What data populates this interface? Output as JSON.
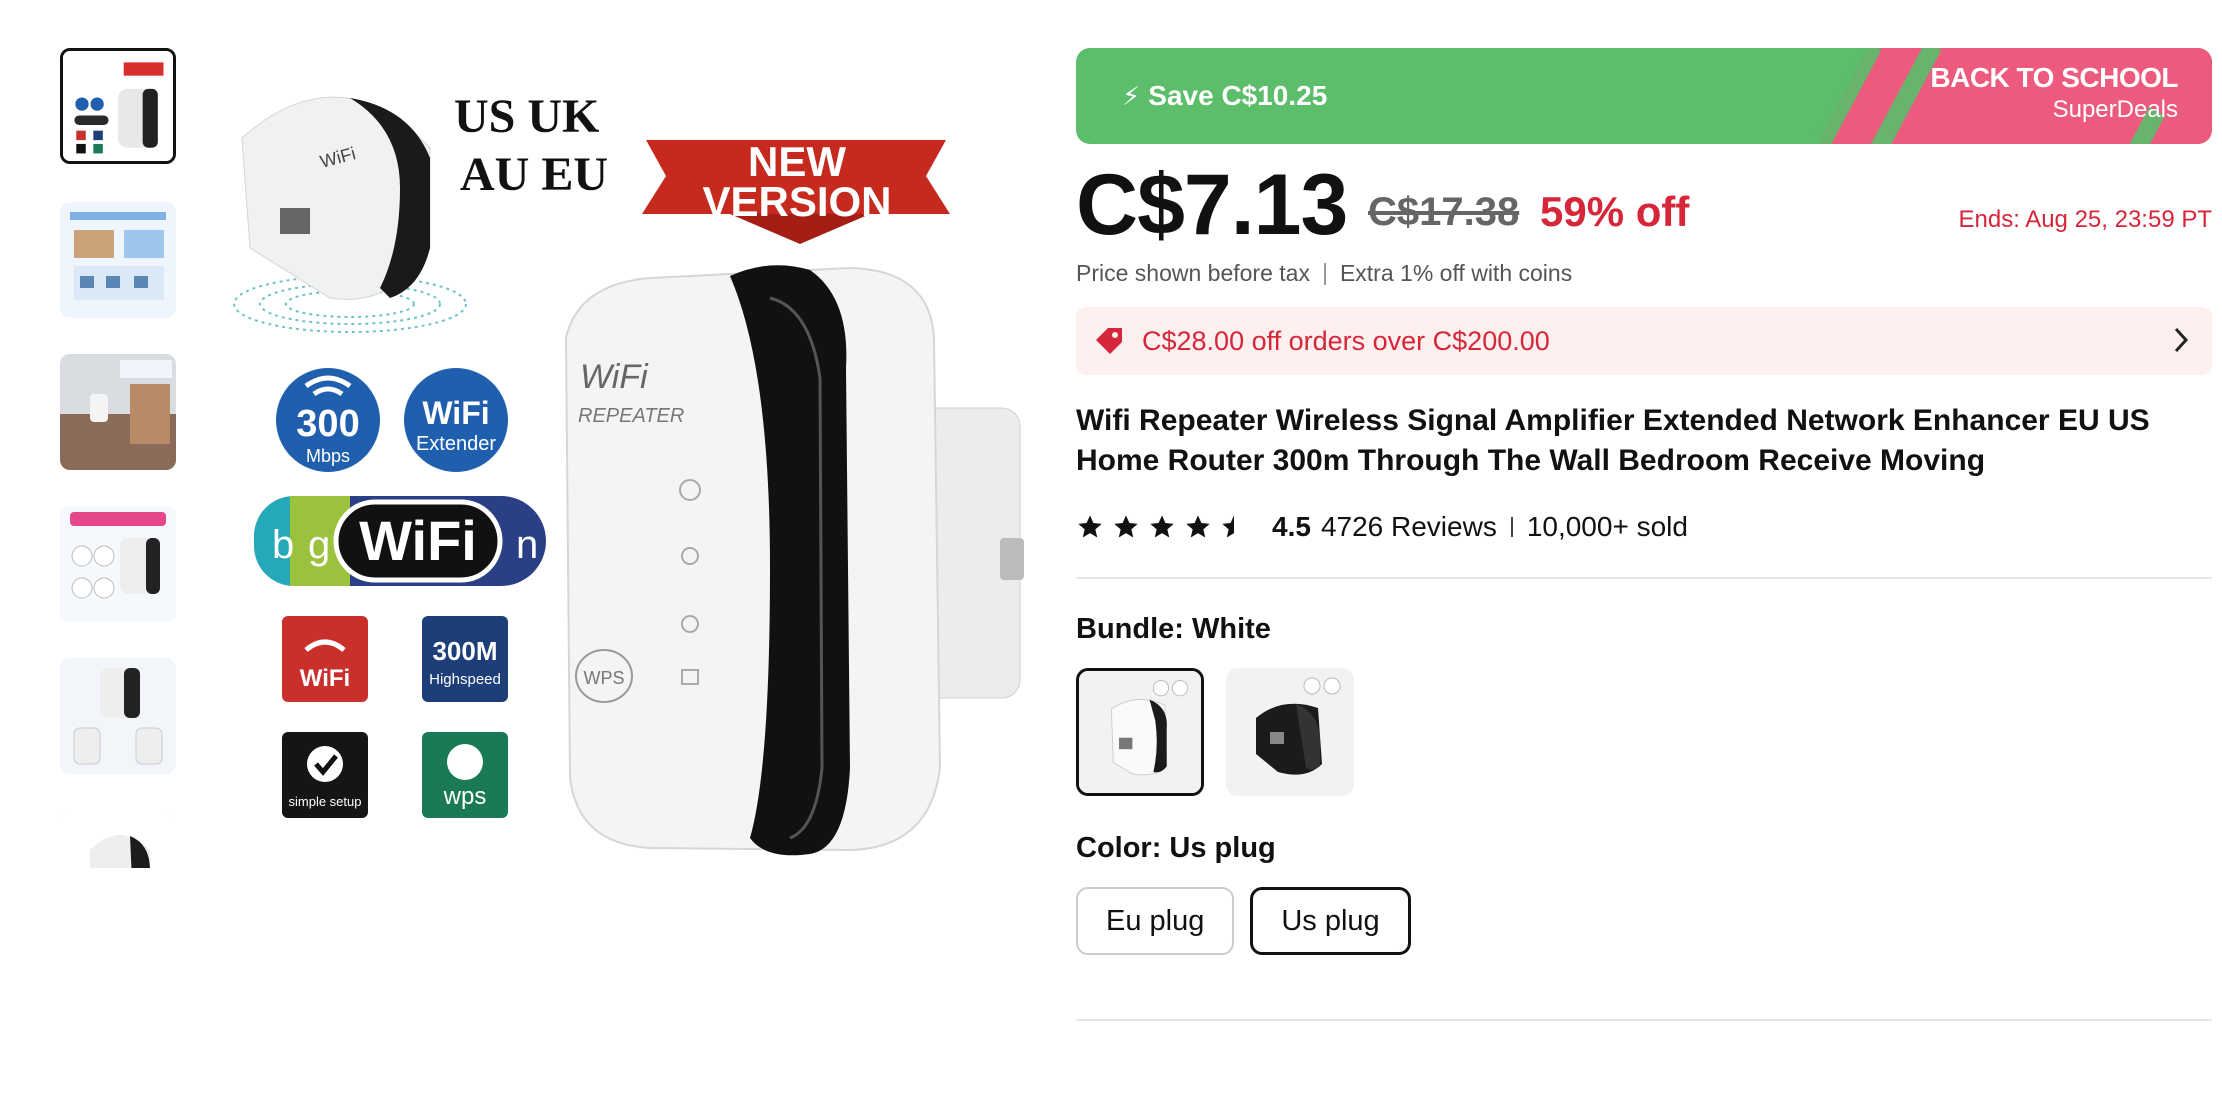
{
  "deal": {
    "save_label": "Save C$10.25",
    "campaign_title": "BACK TO SCHOOL",
    "campaign_sub": "SuperDeals",
    "colors": {
      "green": "#5cbd6b",
      "pink": "#ec5a7e"
    }
  },
  "price": {
    "current": "C$7.13",
    "original": "C$17.38",
    "discount": "59% off",
    "ends": "Ends: Aug 25, 23:59 PT",
    "tax_note": "Price shown before tax",
    "coins_note": "Extra 1% off with coins"
  },
  "coupon": {
    "text": "C$28.00 off orders over C$200.00",
    "icon": "tag-icon"
  },
  "product": {
    "title": "Wifi Repeater Wireless Signal Amplifier Extended Network Enhancer EU US Home Router 300m Through The Wall Bedroom Receive Moving"
  },
  "rating": {
    "score": "4.5",
    "stars": 4.5,
    "reviews": "4726 Reviews",
    "sold": "10,000+ sold"
  },
  "bundle": {
    "label": "Bundle: White",
    "options": [
      "White",
      "Black"
    ],
    "selected": "White"
  },
  "color": {
    "label": "Color: Us plug",
    "options": [
      "Eu plug",
      "Us plug"
    ],
    "selected": "Us plug"
  },
  "image_text": {
    "regions": "US UK\nAU EU",
    "new_version_1": "NEW",
    "new_version_2": "VERSION",
    "speed_num": "300",
    "speed_unit": "Mbps",
    "extender_1": "WiFi",
    "extender_2": "Extender",
    "wifi_b": "b",
    "wifi_g": "g",
    "wifi_word": "WiFi",
    "wifi_n": "n",
    "icon_wifi": "WiFi",
    "icon_300m": "300M",
    "icon_highspeed": "Highspeed",
    "icon_setup": "simple setup",
    "icon_wps": "wps",
    "device_brand": "WiFi",
    "device_model": "REPEATER",
    "device_wps": "WPS"
  }
}
